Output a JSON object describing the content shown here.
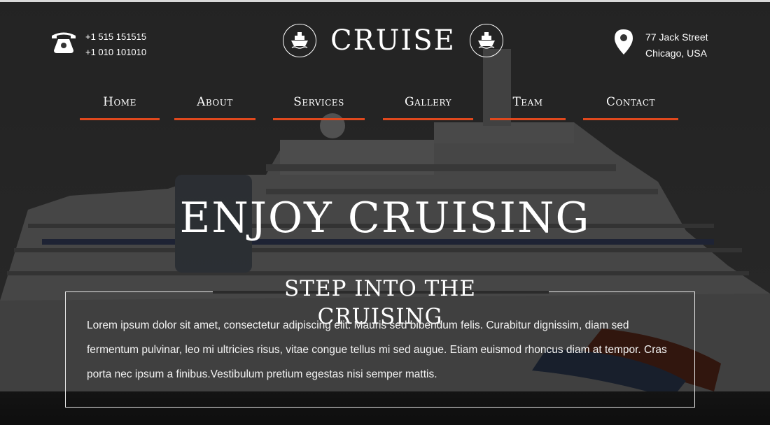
{
  "header": {
    "phones": [
      "+1 515 151515",
      "+1 010 101010"
    ],
    "brand": "CRUISE",
    "address": [
      "77 Jack Street",
      "Chicago, USA"
    ],
    "icons": {
      "phone": "telephone-icon",
      "ship": "cruise-ship-icon",
      "location": "map-pin-icon"
    }
  },
  "nav": {
    "items": [
      {
        "label": "Home"
      },
      {
        "label": "About"
      },
      {
        "label": "Services"
      },
      {
        "label": "Gallery"
      },
      {
        "label": "Team"
      },
      {
        "label": "Contact"
      }
    ],
    "accent": "#e0481d"
  },
  "hero": {
    "title": "ENJOY CRUISING",
    "subtitle": "STEP INTO THE CRUISING",
    "body": "Lorem ipsum dolor sit amet, consectetur adipiscing elit. Mauris sed bibendum felis. Curabitur dignissim, diam sed fermentum pulvinar, leo mi ultricies risus, vitae congue tellus mi sed augue. Etiam euismod rhoncus diam at tempor. Cras porta nec ipsum a finibus.Vestibulum pretium egestas nisi semper mattis."
  }
}
